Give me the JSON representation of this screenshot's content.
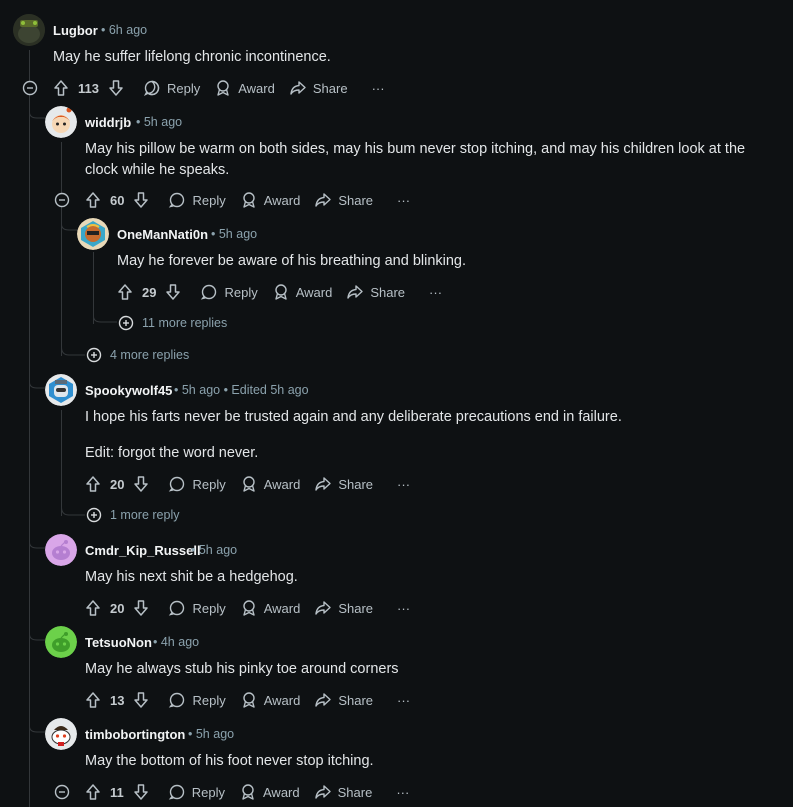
{
  "comments": [
    {
      "author": "Lugbor",
      "time": "6h ago",
      "body": "May he suffer lifelong chronic incontinence.",
      "score": "113"
    },
    {
      "author": "widdrjb",
      "time": "5h ago",
      "body": "May his pillow be warm on both sides, may his bum never stop itching, and may his children look at the clock while he speaks.",
      "score": "60"
    },
    {
      "author": "OneManNati0n",
      "time": "5h ago",
      "body": "May he forever be aware of his breathing and blinking.",
      "score": "29"
    },
    {
      "author": "Spookywolf45",
      "time": "5h ago",
      "edited": "Edited 5h ago",
      "body": "I hope his farts never be trusted again and any deliberate precautions end in failure.",
      "body2": "Edit: forgot the word never.",
      "score": "20"
    },
    {
      "author": "Cmdr_Kip_Russell",
      "time": "5h ago",
      "body": "May his next shit be a hedgehog.",
      "score": "20"
    },
    {
      "author": "TetsuoNon",
      "time": "4h ago",
      "body": "May he always stub his pinky toe around corners",
      "score": "13"
    },
    {
      "author": "timbobortington",
      "time": "5h ago",
      "body": "May the bottom of his foot never stop itching.",
      "score": "11"
    }
  ],
  "actions": {
    "reply": "Reply",
    "award": "Award",
    "share": "Share",
    "more": "···"
  },
  "more_replies": {
    "onemannation": "11 more replies",
    "widdrjb": "4 more replies",
    "spookywolf": "1 more reply"
  },
  "colors": {
    "background": "#0e1113",
    "thread_line": "#33373a",
    "meta": "#8ba2ad"
  }
}
